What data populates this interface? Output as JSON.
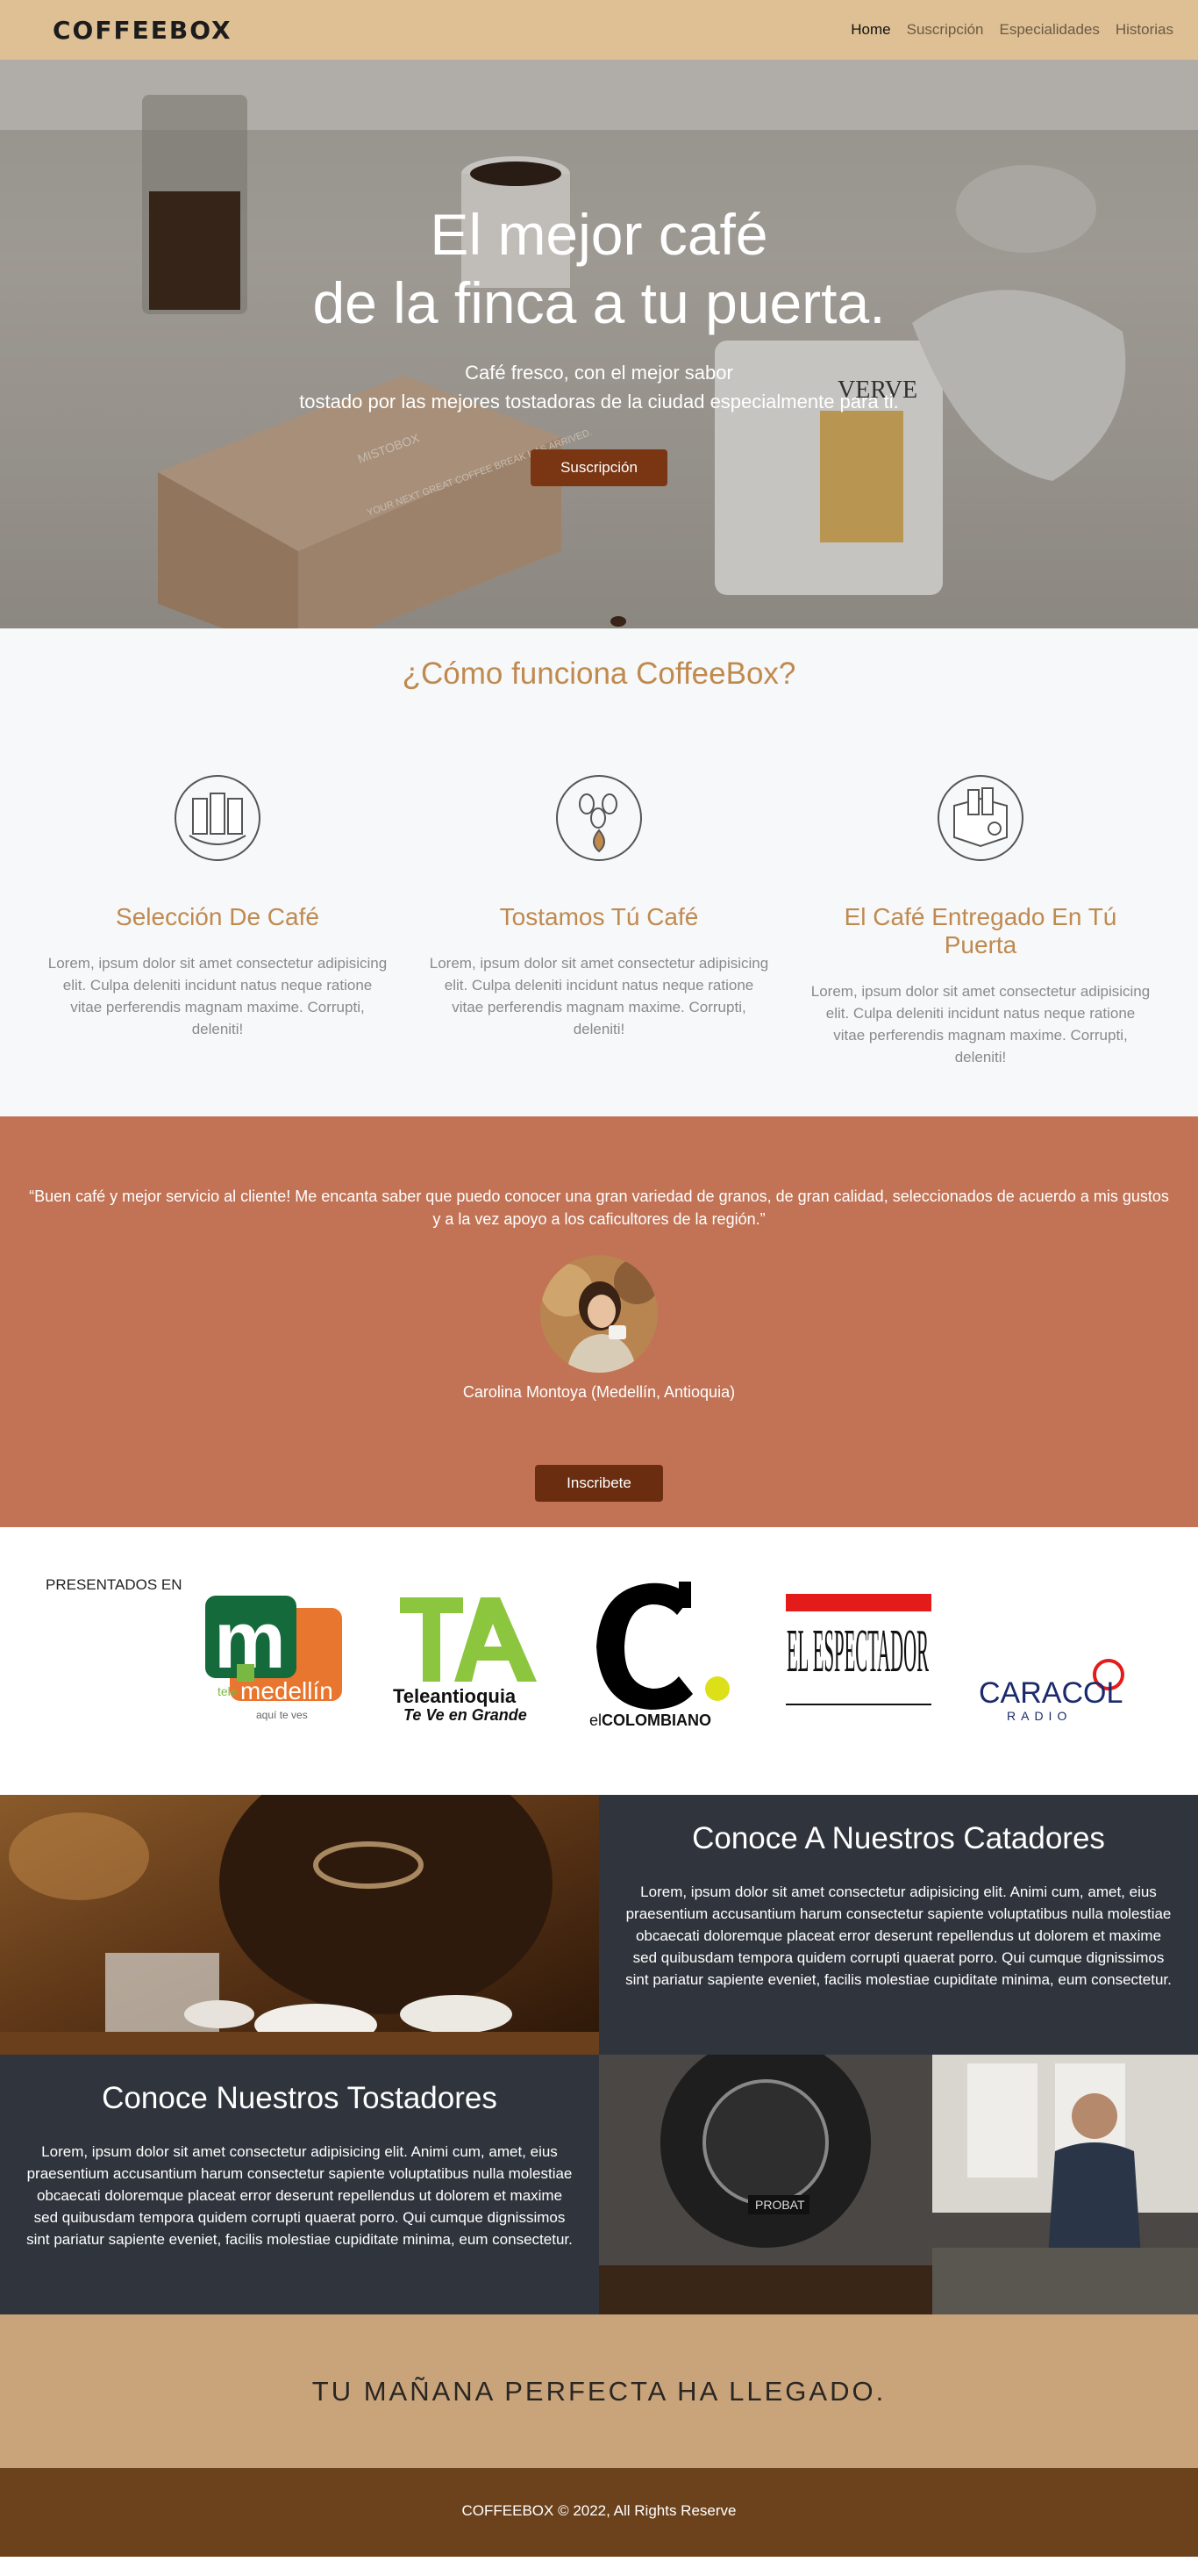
{
  "nav": {
    "brand": "COFFEEBOX",
    "links": [
      "Home",
      "Suscripción",
      "Especialidades",
      "Historias"
    ]
  },
  "hero": {
    "title_line1": "El mejor café",
    "title_line2": "de la finca a tu puerta.",
    "subtitle_line1": "Café fresco, con el mejor sabor",
    "subtitle_line2": "tostado por las mejores tostadoras de la ciudad especialmente para ti.",
    "button": "Suscripción"
  },
  "how": {
    "title": "¿Cómo funciona CoffeeBox?",
    "steps": [
      {
        "title": "Selección De Café",
        "text": "Lorem, ipsum dolor sit amet consectetur adipisicing elit. Culpa deleniti incidunt natus neque ratione vitae perferendis magnam maxime. Corrupti, deleniti!",
        "icon": "coffee-bags-icon"
      },
      {
        "title": "Tostamos Tú Café",
        "text": "Lorem, ipsum dolor sit amet consectetur adipisicing elit. Culpa deleniti incidunt natus neque ratione vitae perferendis magnam maxime. Corrupti, deleniti!",
        "icon": "roasting-beans-icon"
      },
      {
        "title": "El Café Entregado En Tú Puerta",
        "text": "Lorem, ipsum dolor sit amet consectetur adipisicing elit. Culpa deleniti incidunt natus neque ratione vitae perferendis magnam maxime. Corrupti, deleniti!",
        "icon": "delivery-box-icon"
      }
    ]
  },
  "testimonial": {
    "quote": "“Buen café y mejor servicio al cliente! Me encanta saber que puedo conocer una gran variedad de granos, de gran calidad, seleccionados de acuerdo a mis gustos y a la vez apoyo a los caficultores de la región.”",
    "name": "Carolina Montoya (Medellín, Antioquia)",
    "button": "Inscribete"
  },
  "press": {
    "label": "PRESENTADOS EN",
    "telemedellin": {
      "tele": "tele",
      "medellin": "medellín",
      "tag": "aquí te ves"
    },
    "teleantioquia": {
      "name": "Teleantioquia",
      "tag": "Te Ve en Grande"
    },
    "colombiano": {
      "el": "el",
      "name": "COLOMBIANO"
    },
    "espectador": {
      "name": "EL ESPECTADOR"
    },
    "caracol": {
      "name": "CARACOL",
      "sub": "RADIO"
    }
  },
  "catadores": {
    "title": "Conoce A Nuestros Catadores",
    "text": "Lorem, ipsum dolor sit amet consectetur adipisicing elit. Animi cum, amet, eius praesentium accusantium harum consectetur sapiente voluptatibus nulla molestiae obcaecati doloremque placeat error deserunt repellendus ut dolorem et maxime sed quibusdam tempora quidem corrupti quaerat porro. Qui cumque dignissimos sint pariatur sapiente eveniet, facilis molestiae cupiditate minima, eum consectetur."
  },
  "tostadores": {
    "title": "Conoce Nuestros Tostadores",
    "text": "Lorem, ipsum dolor sit amet consectetur adipisicing elit. Animi cum, amet, eius praesentium accusantium harum consectetur sapiente voluptatibus nulla molestiae obcaecati doloremque placeat error deserunt repellendus ut dolorem et maxime sed quibusdam tempora quidem corrupti quaerat porro. Qui cumque dignissimos sint pariatur sapiente eveniet, facilis molestiae cupiditate minima, eum consectetur.",
    "machine_label": "PROBAT"
  },
  "hero_props": {
    "box_text": "MISTOBOX",
    "box_slogan": "YOUR NEXT GREAT COFFEE BREAK HAS ARRIVED.",
    "bag_text": "VERVE"
  },
  "tagline": "TU MAÑANA PERFECTA HA LLEGADO.",
  "footer": "COFFEEBOX © 2022, All Rights Reserve"
}
